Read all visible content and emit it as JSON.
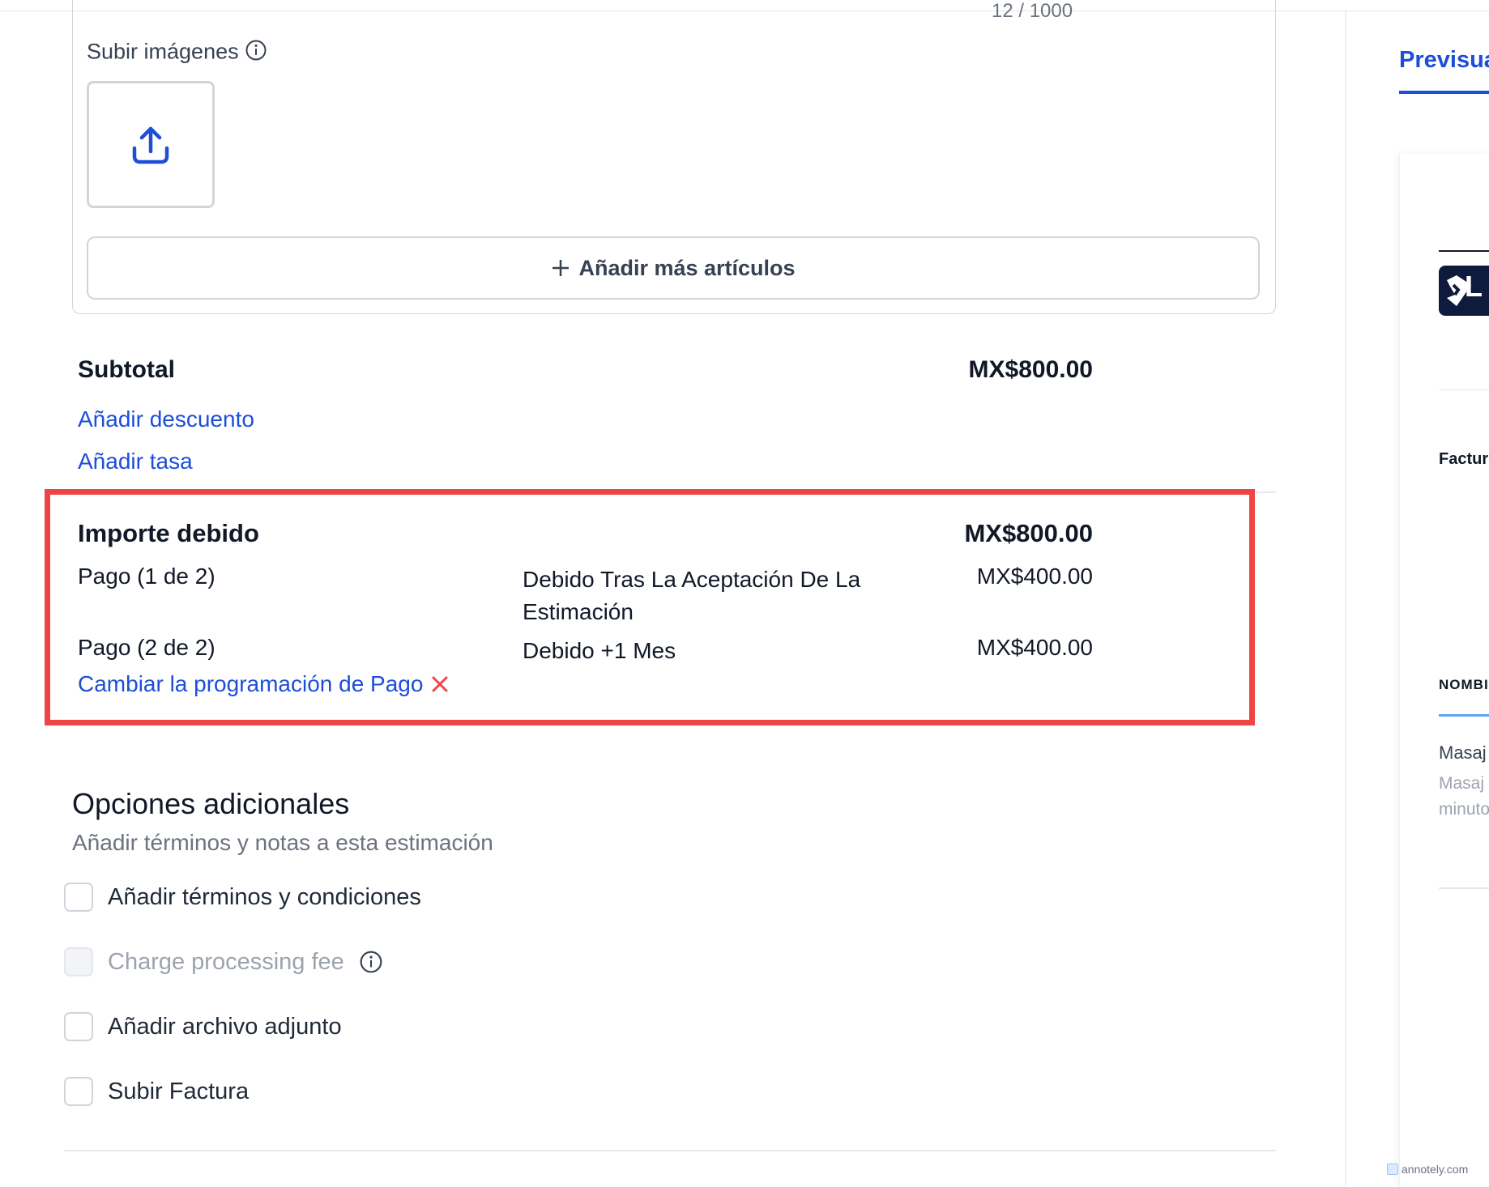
{
  "items_card": {
    "char_counter": "12 / 1000",
    "upload_label": "Subir imágenes",
    "add_items_label": "Añadir más artículos"
  },
  "totals": {
    "subtotal_label": "Subtotal",
    "subtotal_value": "MX$800.00",
    "add_discount": "Añadir descuento",
    "add_tax": "Añadir tasa",
    "amount_due_label": "Importe debido",
    "amount_due_value": "MX$800.00",
    "payments": [
      {
        "name": "Pago (1 de 2)",
        "description": "Debido Tras La Aceptación De La Estimación",
        "amount": "MX$400.00"
      },
      {
        "name": "Pago (2 de 2)",
        "description": "Debido +1 Mes",
        "amount": "MX$400.00"
      }
    ],
    "change_schedule": "Cambiar la programación de Pago"
  },
  "options": {
    "title": "Opciones adicionales",
    "subtitle": "Añadir términos y notas a esta estimación",
    "items": [
      {
        "label": "Añadir términos y condiciones",
        "checked": false,
        "disabled": false
      },
      {
        "label": "Charge processing fee",
        "checked": false,
        "disabled": true
      },
      {
        "label": "Añadir archivo adjunto",
        "checked": false,
        "disabled": false
      },
      {
        "label": "Subir Factura",
        "checked": false,
        "disabled": false
      }
    ]
  },
  "preview": {
    "tab_label": "Previsua",
    "logo_text": "L",
    "factura": "Factur",
    "column_header": "NOMBI",
    "item_name": "Masaj",
    "item_desc_1": "Masaj",
    "item_desc_2": "minuto"
  },
  "watermark": "annotely.com",
  "colors": {
    "accent": "#1d4ed8",
    "highlight": "#ef4444",
    "remove_icon": "#ef4444"
  }
}
